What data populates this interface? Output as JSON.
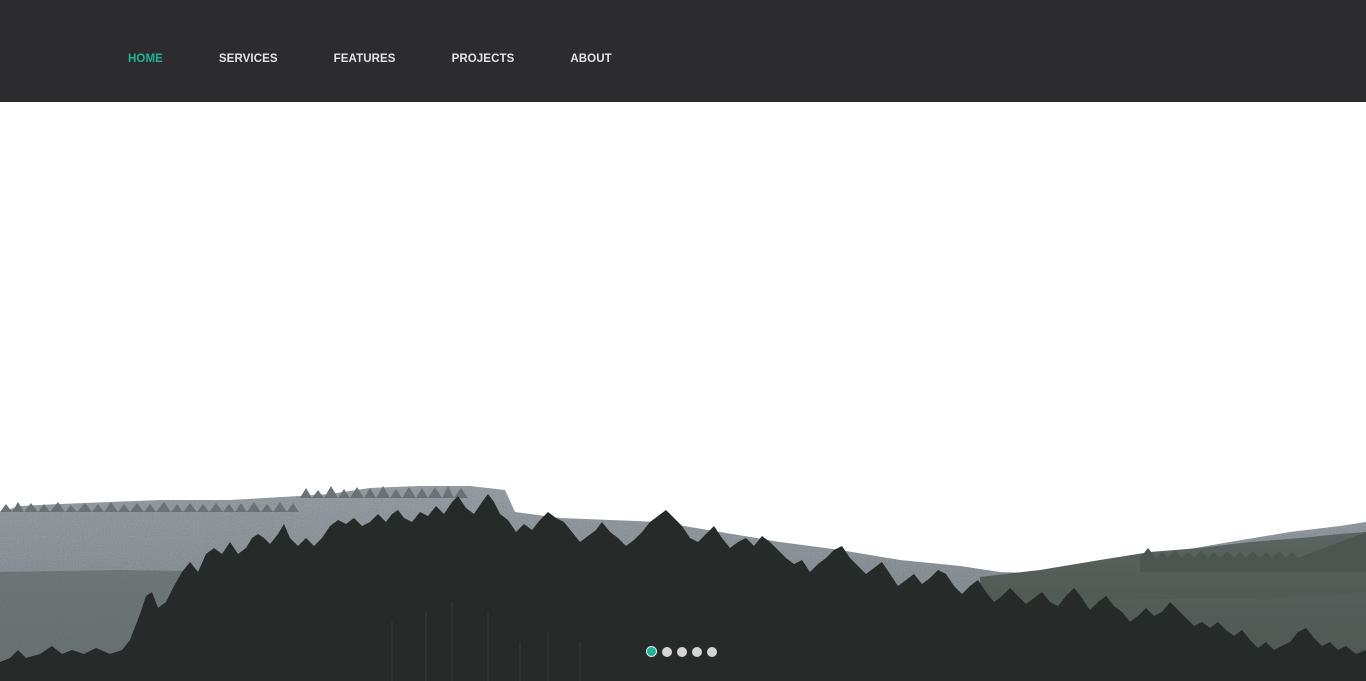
{
  "nav": {
    "items": [
      {
        "label": "HOME",
        "active": true
      },
      {
        "label": "SERVICES",
        "active": false
      },
      {
        "label": "FEATURES",
        "active": false
      },
      {
        "label": "PROJECTS",
        "active": false
      },
      {
        "label": "ABOUT",
        "active": false
      }
    ]
  },
  "colors": {
    "header_bg": "#2c2c2e",
    "accent": "#1fb49a",
    "nav_text": "#e4e4e4",
    "dot_inactive": "#d4d4d4"
  },
  "slider": {
    "slide_count": 5,
    "active_index": 0
  }
}
